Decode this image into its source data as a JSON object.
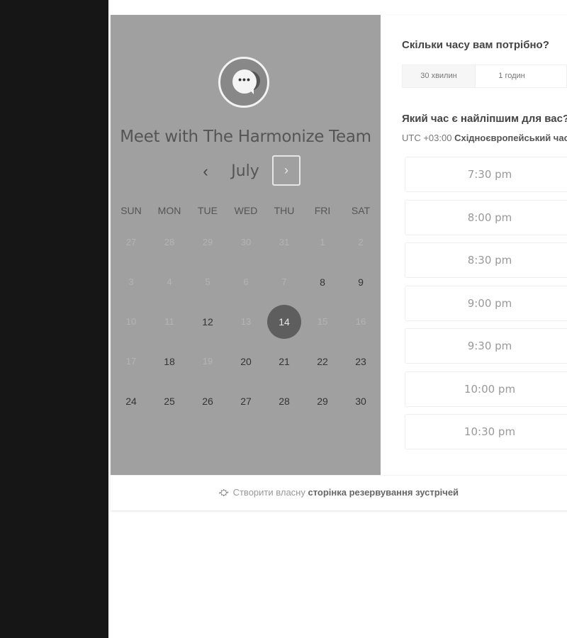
{
  "calendar": {
    "title": "Meet with The Harmonize Team",
    "month": "July",
    "prev_icon": "‹",
    "next_icon": "›",
    "weekdays": [
      "SUN",
      "MON",
      "TUE",
      "WED",
      "THU",
      "FRI",
      "SAT"
    ],
    "weeks": [
      [
        {
          "d": "27",
          "s": "muted"
        },
        {
          "d": "28",
          "s": "muted"
        },
        {
          "d": "29",
          "s": "muted"
        },
        {
          "d": "30",
          "s": "muted"
        },
        {
          "d": "31",
          "s": "muted"
        },
        {
          "d": "1",
          "s": "muted"
        },
        {
          "d": "2",
          "s": "muted"
        }
      ],
      [
        {
          "d": "3",
          "s": "muted"
        },
        {
          "d": "4",
          "s": "muted"
        },
        {
          "d": "5",
          "s": "muted"
        },
        {
          "d": "6",
          "s": "muted"
        },
        {
          "d": "7",
          "s": "muted"
        },
        {
          "d": "8",
          "s": "active"
        },
        {
          "d": "9",
          "s": "active"
        }
      ],
      [
        {
          "d": "10",
          "s": "muted"
        },
        {
          "d": "11",
          "s": "muted"
        },
        {
          "d": "12",
          "s": "active"
        },
        {
          "d": "13",
          "s": "muted"
        },
        {
          "d": "14",
          "s": "selected"
        },
        {
          "d": "15",
          "s": "muted"
        },
        {
          "d": "16",
          "s": "muted"
        }
      ],
      [
        {
          "d": "17",
          "s": "muted"
        },
        {
          "d": "18",
          "s": "active"
        },
        {
          "d": "19",
          "s": "muted"
        },
        {
          "d": "20",
          "s": "active"
        },
        {
          "d": "21",
          "s": "active"
        },
        {
          "d": "22",
          "s": "active"
        },
        {
          "d": "23",
          "s": "active"
        }
      ],
      [
        {
          "d": "24",
          "s": "active"
        },
        {
          "d": "25",
          "s": "active"
        },
        {
          "d": "26",
          "s": "active"
        },
        {
          "d": "27",
          "s": "active"
        },
        {
          "d": "28",
          "s": "active"
        },
        {
          "d": "29",
          "s": "active"
        },
        {
          "d": "30",
          "s": "active"
        }
      ]
    ]
  },
  "duration": {
    "question": "Скільки часу вам потрібно?",
    "options": [
      "30 хвилин",
      "1 годин"
    ]
  },
  "times": {
    "question": "Який час є найліпшим для вас?",
    "timezone_offset": "UTC +03:00",
    "timezone_name": "Східноєвропейський час",
    "slots": [
      "7:30 pm",
      "8:00 pm",
      "8:30 pm",
      "9:00 pm",
      "9:30 pm",
      "10:00 pm",
      "10:30 pm"
    ]
  },
  "footer": {
    "prefix": "Створити власну",
    "link": "сторінка резервування зустрічей",
    "icon": "hubspot-sprocket-icon"
  },
  "colors": {
    "calendar_panel": "#a0a0a0",
    "selected_day": "#5e5e5e",
    "sidebar_dark": "#161616"
  }
}
